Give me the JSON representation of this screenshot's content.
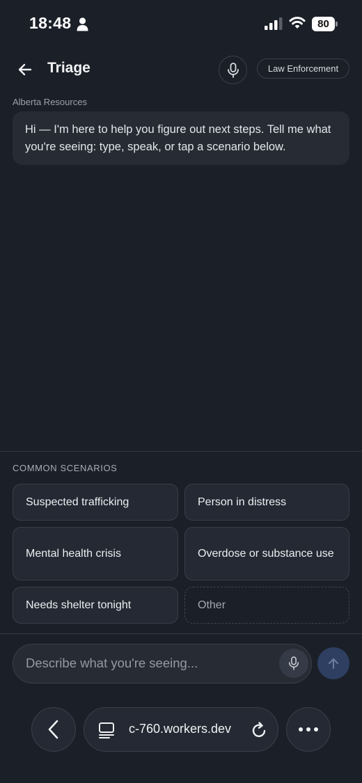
{
  "status_bar": {
    "time": "18:48",
    "battery": "80",
    "icons": [
      "person-icon",
      "signal-icon",
      "wifi-icon",
      "battery-icon"
    ]
  },
  "header": {
    "title": "Triage",
    "back_icon": "arrow-left-icon",
    "mic_icon": "microphone-icon",
    "role_label": "Law Enforcement"
  },
  "chat": {
    "sender": "Alberta Resources",
    "message": "Hi — I'm here to help you figure out next steps. Tell me what you're seeing: type, speak, or tap a scenario below."
  },
  "scenarios": {
    "heading": "COMMON SCENARIOS",
    "items": [
      "Suspected trafficking",
      "Person in distress",
      "Mental health crisis",
      "Overdose or substance use",
      "Needs shelter tonight",
      "Other"
    ]
  },
  "composer": {
    "placeholder": "Describe what you're seeing...",
    "value": "",
    "mic_icon": "microphone-icon",
    "send_icon": "arrow-up-icon"
  },
  "browser": {
    "url": "c-760.workers.dev",
    "icons": [
      "chevron-left-icon",
      "tabs-icon",
      "reload-icon",
      "more-icon"
    ]
  },
  "colors": {
    "background": "#1b1f27",
    "surface": "#262b34",
    "border": "#3a404b",
    "send_button": "#2e3f62"
  }
}
